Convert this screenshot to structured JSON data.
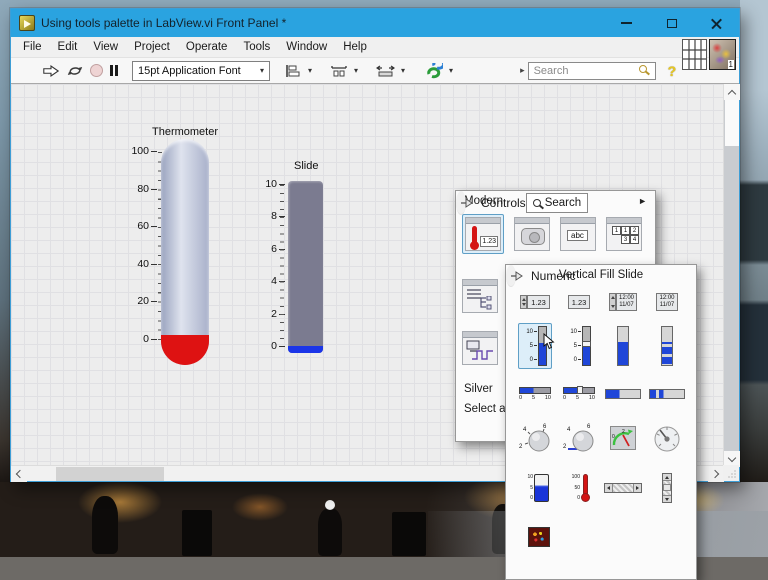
{
  "colors": {
    "titlebar_blue": "#2aa3e0",
    "selection_blue": "#5f9fc6",
    "thermometer_red": "#de1212",
    "slide_fill_blue": "#1b35e8",
    "palette_fill_blue": "#1f46d8",
    "canvas_gray": "#ededed"
  },
  "icons": {
    "modern_arrow": "►",
    "dropdown": "▾",
    "search_caret": "▸",
    "help": "?"
  },
  "window": {
    "title": "Using tools palette in LabView.vi Front Panel *"
  },
  "menu": {
    "items": [
      {
        "label": "File"
      },
      {
        "label": "Edit"
      },
      {
        "label": "View"
      },
      {
        "label": "Project"
      },
      {
        "label": "Operate"
      },
      {
        "label": "Tools"
      },
      {
        "label": "Window"
      },
      {
        "label": "Help"
      }
    ]
  },
  "toolbar": {
    "font_selector": "15pt Application Font",
    "search_placeholder": "Search",
    "vi_badge": "1"
  },
  "front_panel": {
    "thermometer": {
      "label": "Thermometer",
      "ticks": [
        "100",
        "80",
        "60",
        "40",
        "20",
        "0"
      ]
    },
    "slide": {
      "label": "Slide",
      "ticks": [
        "10",
        "8",
        "6",
        "4",
        "2",
        "0"
      ]
    }
  },
  "controls_palette": {
    "title": "Controls",
    "search_label": "Search",
    "category": "Modern",
    "silver": "Silver",
    "select": "Select a",
    "items": {
      "numeric_value": "1.23",
      "string_icon": "abc",
      "array_cells": [
        "1",
        "1",
        "2",
        "3",
        "4"
      ]
    }
  },
  "numeric_palette": {
    "title": "Numeric",
    "tooltip": "Vertical Fill Slide",
    "numeric_value": "1.23",
    "time_value": "12:00",
    "date_value": "11/07",
    "v_ticks": [
      "10",
      "5",
      "0"
    ],
    "h_ticks": [
      "0",
      "5",
      "10"
    ],
    "knob_ticks": [
      "2",
      "4",
      "6"
    ],
    "meter_ticks": [
      "0",
      "2"
    ],
    "tank_ticks": [
      "10",
      "5",
      "0"
    ],
    "thermo_ticks": [
      "100",
      "50",
      "0"
    ]
  }
}
